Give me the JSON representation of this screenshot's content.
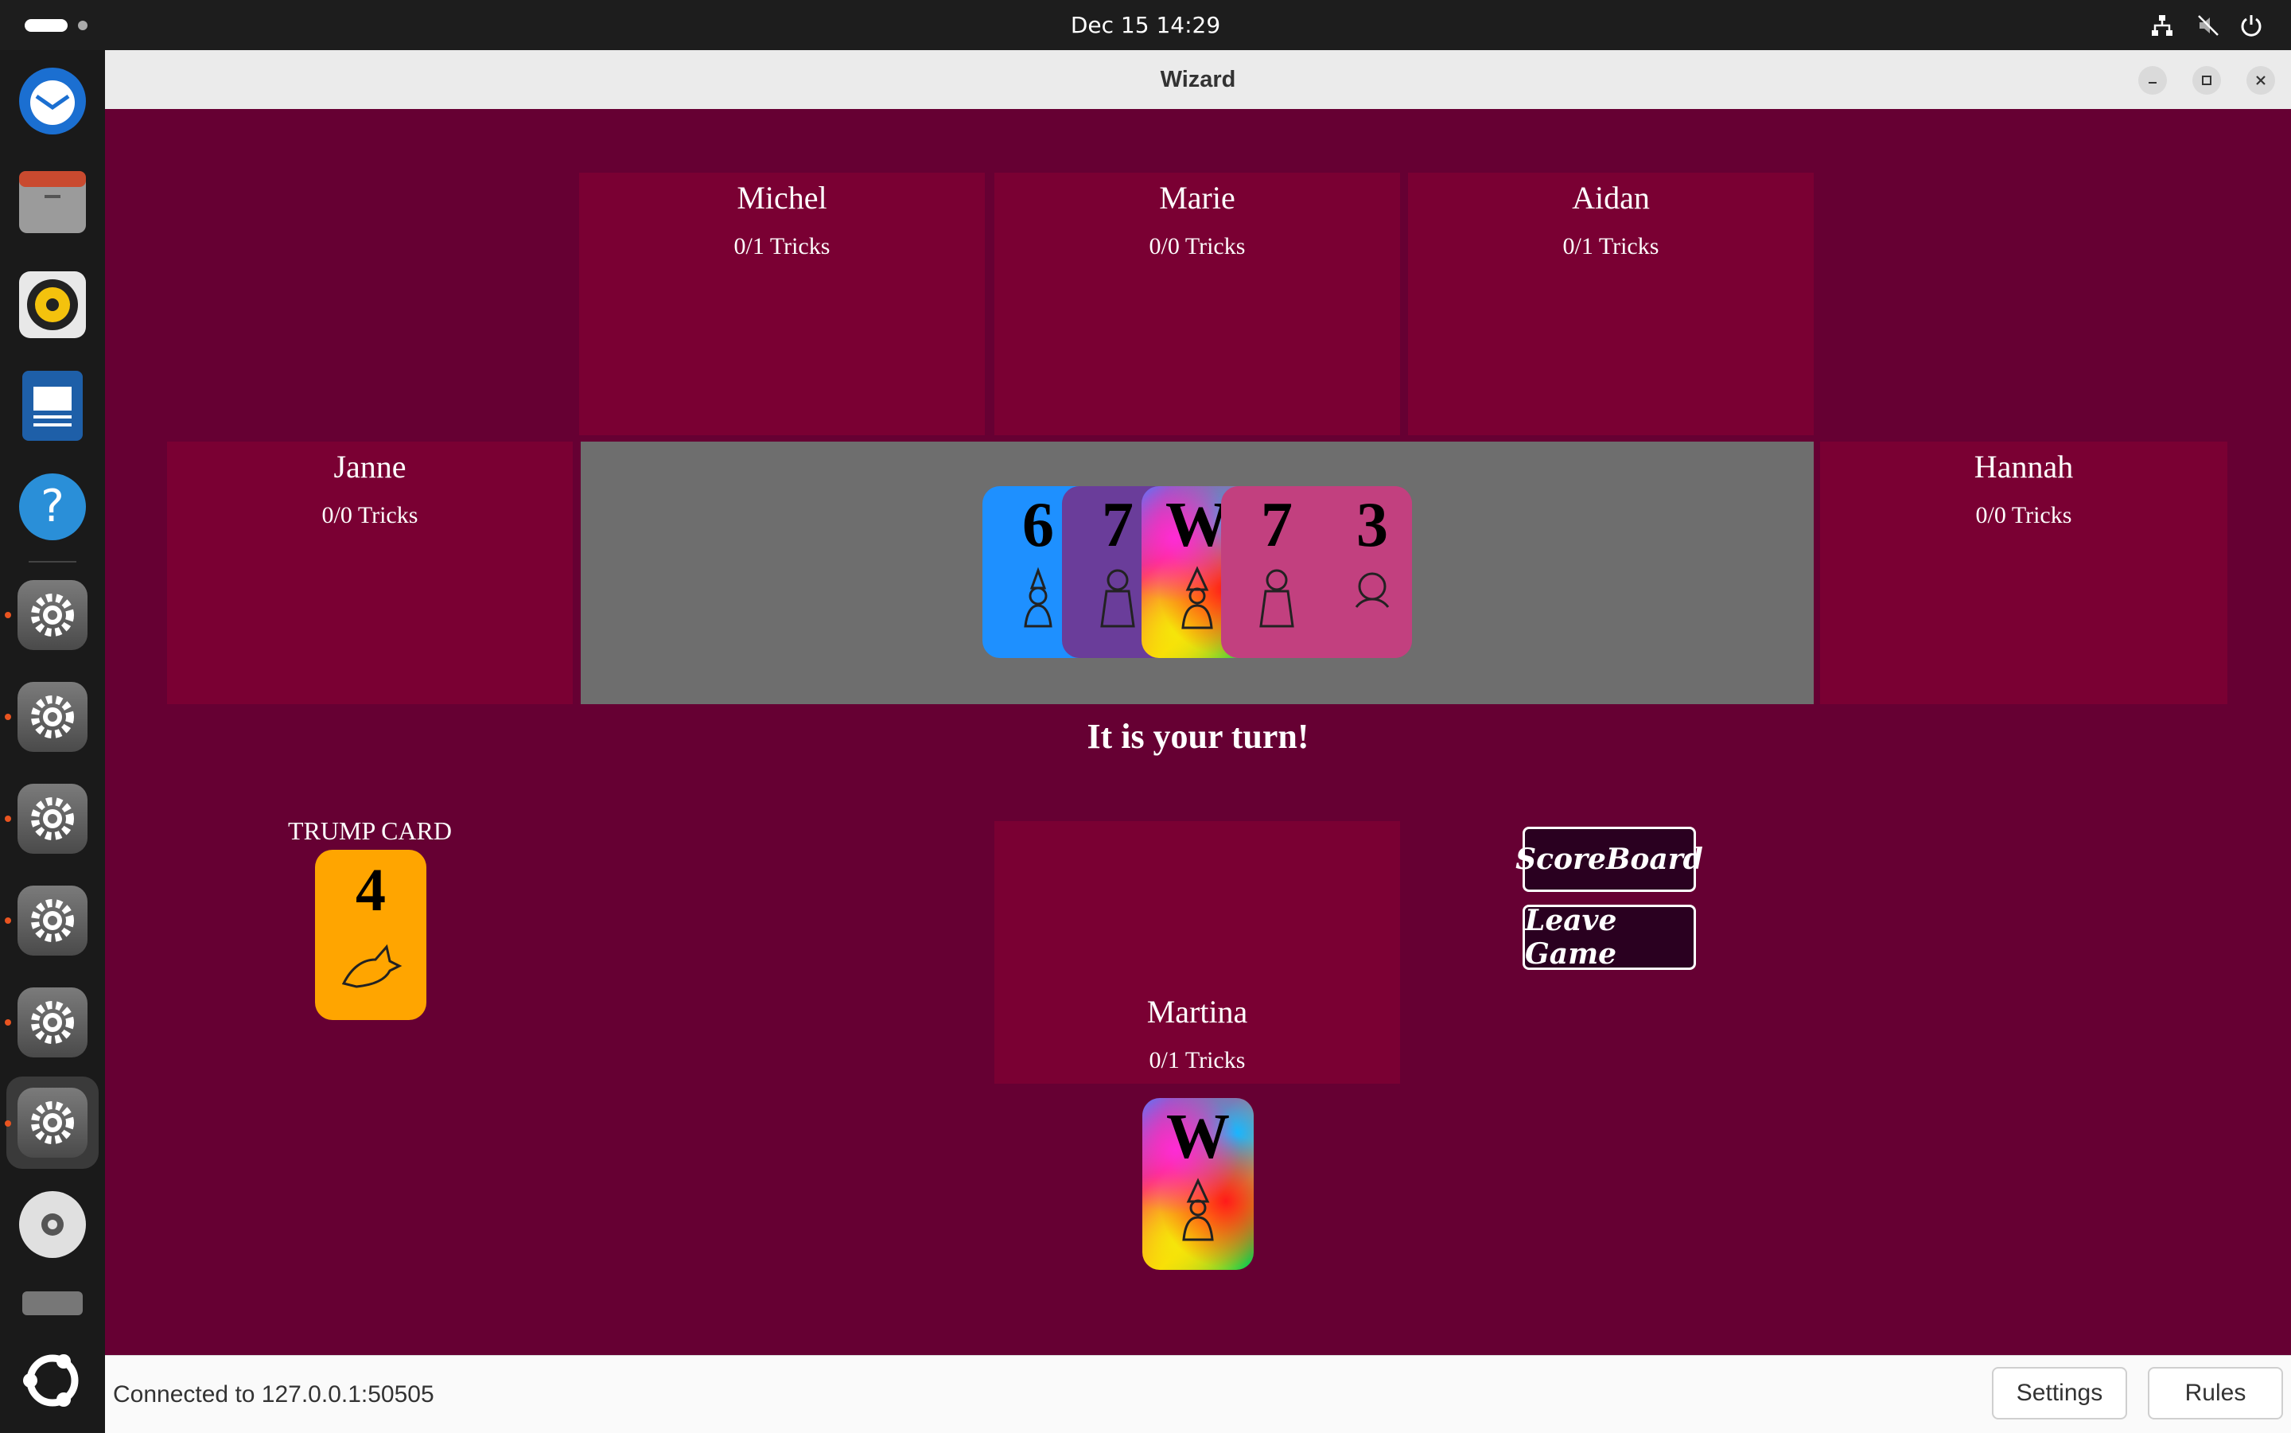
{
  "topbar": {
    "clock": "Dec 15  14:29"
  },
  "dock": {
    "items": [
      {
        "name": "thunderbird-icon"
      },
      {
        "name": "files-icon"
      },
      {
        "name": "rhythmbox-icon"
      },
      {
        "name": "writer-icon"
      },
      {
        "name": "help-icon"
      },
      {
        "name": "settings-icon"
      },
      {
        "name": "settings-icon"
      },
      {
        "name": "settings-icon"
      },
      {
        "name": "settings-icon"
      },
      {
        "name": "settings-icon"
      },
      {
        "name": "settings-icon"
      },
      {
        "name": "disc-icon"
      },
      {
        "name": "drive-icon"
      }
    ]
  },
  "window": {
    "title": "Wizard"
  },
  "players": {
    "michel": {
      "name": "Michel",
      "tricks": "0/1 Tricks"
    },
    "marie": {
      "name": "Marie",
      "tricks": "0/0 Tricks"
    },
    "aidan": {
      "name": "Aidan",
      "tricks": "0/1 Tricks"
    },
    "janne": {
      "name": "Janne",
      "tricks": "0/0 Tricks"
    },
    "hannah": {
      "name": "Hannah",
      "tricks": "0/0 Tricks"
    },
    "martina": {
      "name": "Martina",
      "tricks": "0/1 Tricks"
    }
  },
  "table_cards": [
    {
      "value": "6",
      "color": "#1e90ff",
      "figure": "elf"
    },
    {
      "value": "7",
      "color": "#6a3d9a",
      "figure": "giant"
    },
    {
      "value": "W",
      "color": "rainbow",
      "figure": "wizard"
    },
    {
      "value": "7",
      "color": "#c2407f",
      "figure": "giant"
    },
    {
      "value": "3",
      "color": "#c2407f",
      "figure": "dwarf"
    }
  ],
  "turn_message": "It is your turn!",
  "trump": {
    "label": "TRUMP CARD",
    "value": "4",
    "color": "#ffa500",
    "figure": "dragon"
  },
  "hand": [
    {
      "value": "W",
      "color": "rainbow",
      "figure": "wizard"
    }
  ],
  "buttons": {
    "scoreboard": "ScoreBoard",
    "leave": "Leave Game"
  },
  "status": {
    "text": "Connected to 127.0.0.1:50505",
    "settings": "Settings",
    "rules": "Rules"
  }
}
